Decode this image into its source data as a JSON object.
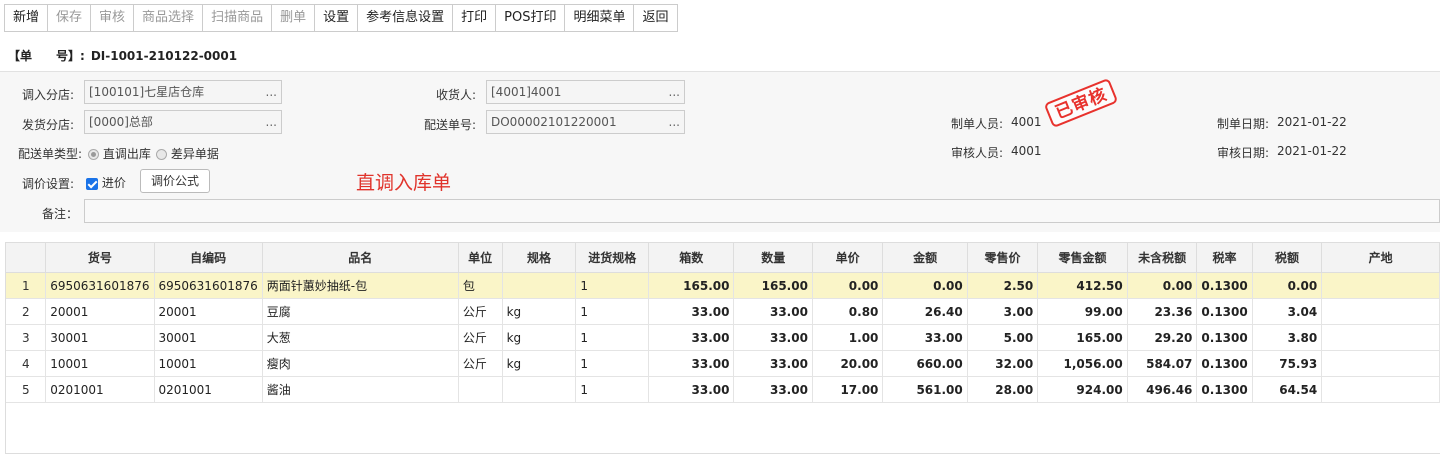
{
  "toolbar": {
    "buttons": [
      {
        "label": "新增",
        "enabled": true
      },
      {
        "label": "保存",
        "enabled": false
      },
      {
        "label": "审核",
        "enabled": false
      },
      {
        "label": "商品选择",
        "enabled": false
      },
      {
        "label": "扫描商品",
        "enabled": false
      },
      {
        "label": "删单",
        "enabled": false
      },
      {
        "label": "设置",
        "enabled": true
      },
      {
        "label": "参考信息设置",
        "enabled": true
      },
      {
        "label": "打印",
        "enabled": true
      },
      {
        "label": "POS打印",
        "enabled": true
      },
      {
        "label": "明细菜单",
        "enabled": true
      },
      {
        "label": "返回",
        "enabled": true
      }
    ]
  },
  "doc": {
    "label": "【单　　号】:",
    "number": "DI-1001-210122-0001"
  },
  "form": {
    "to_store_label": "调入分店:",
    "to_store_value": "[100101]七星店仓库",
    "from_store_label": "发货分店:",
    "from_store_value": "[0000]总部",
    "receiver_label": "收货人:",
    "receiver_value": "[4001]4001",
    "delivery_no_label": "配送单号:",
    "delivery_no_value": "DO00002101220001",
    "type_label": "配送单类型:",
    "type_opt1": "直调出库",
    "type_opt2": "差异单据",
    "price_label": "调价设置:",
    "price_check_label": "进价",
    "price_formula_btn": "调价公式",
    "remark_label": "备注：",
    "remark_value": "",
    "dots": "...",
    "maker_label": "制单人员:",
    "maker_value": "4001",
    "auditor_label": "审核人员:",
    "auditor_value": "4001",
    "make_date_label": "制单日期:",
    "make_date_value": "2021-01-22",
    "audit_date_label": "审核日期:",
    "audit_date_value": "2021-01-22",
    "stamp": "已审核",
    "title": "直调入库单"
  },
  "table": {
    "headers": [
      "",
      "货号",
      "自编码",
      "品名",
      "单位",
      "规格",
      "进货规格",
      "箱数",
      "数量",
      "单价",
      "金额",
      "零售价",
      "零售金额",
      "未含税额",
      "税率",
      "税额",
      "产地"
    ],
    "rows": [
      [
        "1",
        "6950631601876",
        "6950631601876",
        "两面针蕙妙抽纸-包",
        "包",
        "",
        "1",
        "165.00",
        "165.00",
        "0.00",
        "0.00",
        "2.50",
        "412.50",
        "0.00",
        "0.1300",
        "0.00",
        ""
      ],
      [
        "2",
        "20001",
        "20001",
        "豆腐",
        "公斤",
        "kg",
        "1",
        "33.00",
        "33.00",
        "0.80",
        "26.40",
        "3.00",
        "99.00",
        "23.36",
        "0.1300",
        "3.04",
        ""
      ],
      [
        "3",
        "30001",
        "30001",
        "大葱",
        "公斤",
        "kg",
        "1",
        "33.00",
        "33.00",
        "1.00",
        "33.00",
        "5.00",
        "165.00",
        "29.20",
        "0.1300",
        "3.80",
        ""
      ],
      [
        "4",
        "10001",
        "10001",
        "瘦肉",
        "公斤",
        "kg",
        "1",
        "33.00",
        "33.00",
        "20.00",
        "660.00",
        "32.00",
        "1,056.00",
        "584.07",
        "0.1300",
        "75.93",
        ""
      ],
      [
        "5",
        "0201001",
        "0201001",
        "酱油",
        "",
        "",
        "1",
        "33.00",
        "33.00",
        "17.00",
        "561.00",
        "28.00",
        "924.00",
        "496.46",
        "0.1300",
        "64.54",
        ""
      ]
    ],
    "selected_row": 0
  },
  "colors": {
    "accent": "#e0332b",
    "selected_row": "#faf5c8",
    "checkbox": "#1a73e8"
  }
}
